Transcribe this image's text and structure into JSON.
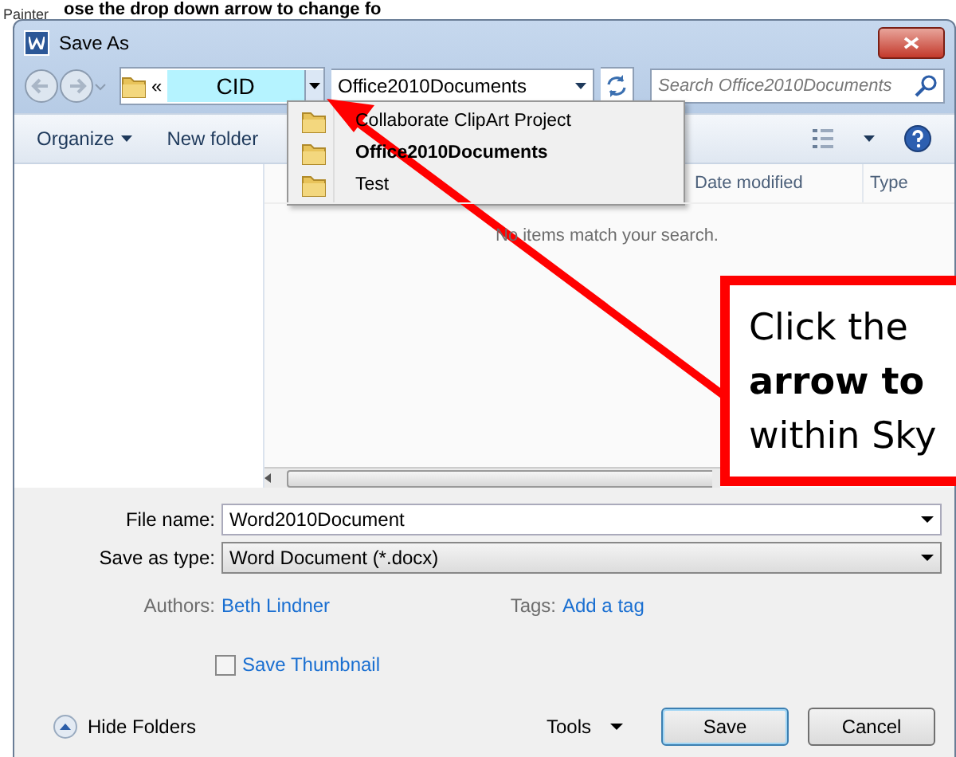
{
  "document": {
    "ribbon_label": "Painter",
    "heading": "ose the drop down arrow to change fo"
  },
  "window": {
    "title": "Save As"
  },
  "address_bar": {
    "breadcrumb_prefix": "«",
    "breadcrumb": "CID",
    "breadcrumb_selected": true,
    "path": "Office2010Documents"
  },
  "search": {
    "placeholder": "Search Office2010Documents"
  },
  "toolbar": {
    "buttons": [
      "Organize",
      "New folder"
    ]
  },
  "columns": [
    "Date modified",
    "Type"
  ],
  "empty_message": "No items match your search.",
  "dropdown": {
    "items": [
      {
        "label": "Collaborate ClipArt Project",
        "selected": false
      },
      {
        "label": "Office2010Documents",
        "selected": true
      },
      {
        "label": "Test",
        "selected": false
      }
    ]
  },
  "form": {
    "file_name": {
      "label": "File name:",
      "value": "Word2010Document"
    },
    "save_as_type": {
      "label": "Save as type:",
      "value": "Word Document (*.docx)"
    },
    "authors": {
      "label": "Authors:",
      "value": "Beth Lindner"
    },
    "tags": {
      "label": "Tags:",
      "value": "Add a tag"
    },
    "thumbnail": {
      "label": "Save Thumbnail",
      "checked": false
    }
  },
  "footer": {
    "hide_folders": "Hide Folders",
    "tools": "Tools",
    "buttons": [
      "Save",
      "Cancel"
    ]
  },
  "callout": {
    "text": "Click the\n**arrow to**\nwithin Sky"
  }
}
